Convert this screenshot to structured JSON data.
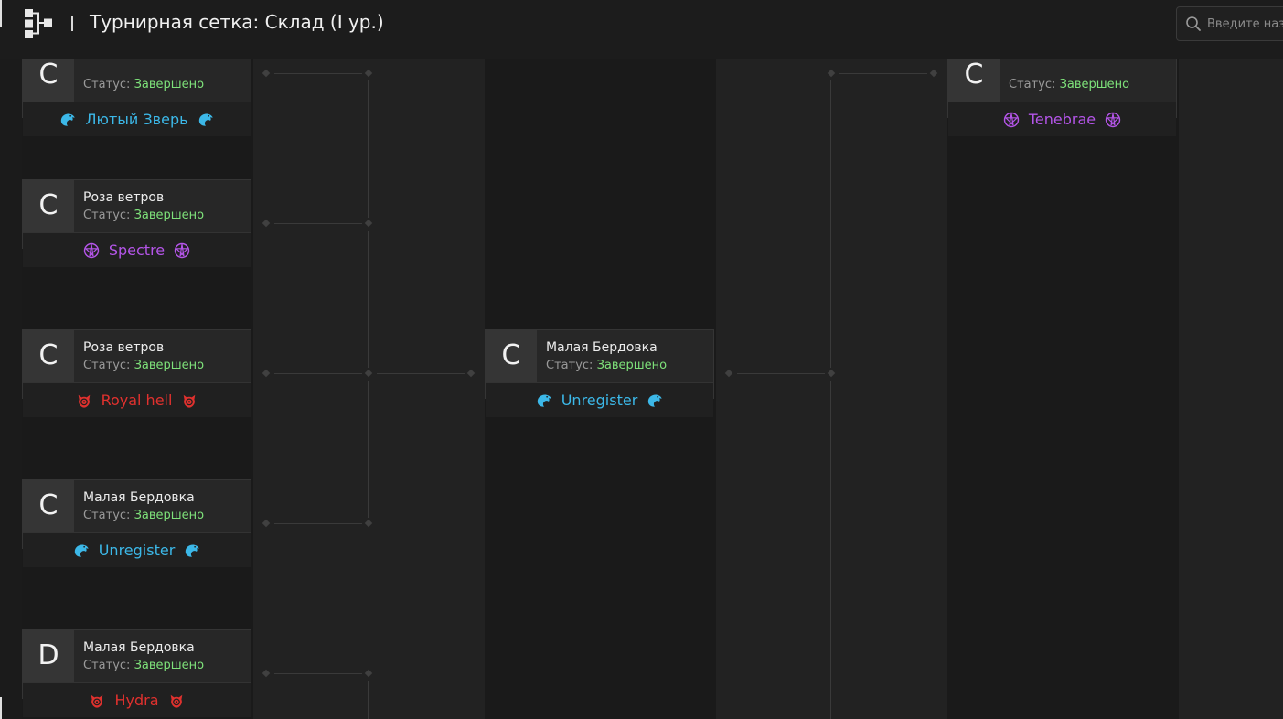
{
  "header": {
    "title": "Турнирная сетка: Склад (I ур.)",
    "search_placeholder": "Введите назв"
  },
  "status_label": "Статус:",
  "matches": [
    {
      "grade": "C",
      "map": "",
      "status": "Завершено",
      "team": "Лютый Зверь",
      "team_icon": "eagle-icon",
      "team_color": "#3cb8e8"
    },
    {
      "grade": "C",
      "map": "Роза ветров",
      "status": "Завершено",
      "team": "Spectre",
      "team_icon": "pentagram-icon",
      "team_color": "#b455e8"
    },
    {
      "grade": "C",
      "map": "Роза ветров",
      "status": "Завершено",
      "team": "Royal hell",
      "team_icon": "demon-icon",
      "team_color": "#e0312e"
    },
    {
      "grade": "C",
      "map": "Малая Бердовка",
      "status": "Завершено",
      "team": "Unregister",
      "team_icon": "eagle-icon",
      "team_color": "#3cb8e8"
    },
    {
      "grade": "D",
      "map": "Малая Бердовка",
      "status": "Завершено",
      "team": "Hydra",
      "team_icon": "demon-icon",
      "team_color": "#e0312e"
    },
    {
      "grade": "C",
      "map": "Малая Бердовка",
      "status": "Завершено",
      "team": "Unregister",
      "team_icon": "eagle-icon",
      "team_color": "#3cb8e8"
    },
    {
      "grade": "C",
      "map": "",
      "status": "Завершено",
      "team": "Tenebrae",
      "team_icon": "pentagram-icon",
      "team_color": "#b455e8"
    }
  ],
  "colors": {
    "status_done": "#7ee27a",
    "eagle": "#3cb8e8",
    "pentagram": "#b455e8",
    "demon": "#e0312e"
  }
}
